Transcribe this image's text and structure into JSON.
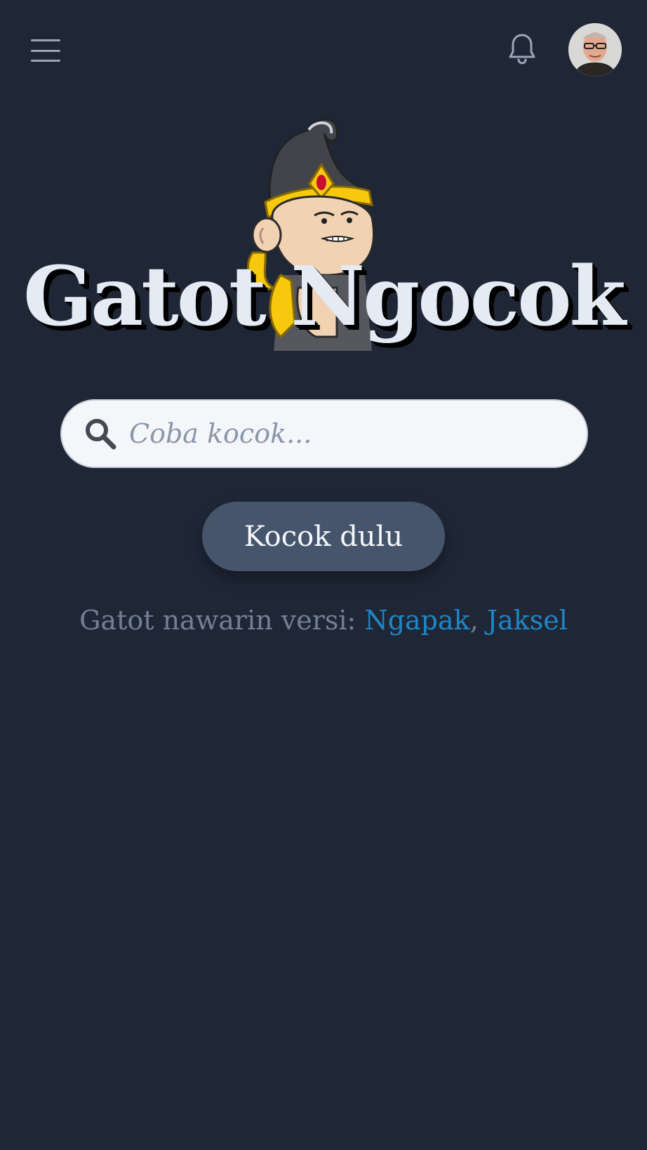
{
  "header": {
    "menu_icon": "hamburger-menu-icon",
    "notification_icon": "bell-icon",
    "avatar": "user-avatar-photo"
  },
  "hero": {
    "title": "Gatot Ngocok",
    "mascot": "gatot-kaca-cartoon-mascot"
  },
  "search": {
    "placeholder": "Coba kocok...",
    "value": "",
    "icon": "search-icon"
  },
  "action": {
    "button_label": "Kocok dulu"
  },
  "versions": {
    "prefix": "Gatot nawarin versi:",
    "links": [
      "Ngapak",
      "Jaksel"
    ]
  },
  "colors": {
    "background": "#1f2736",
    "button": "#46556c",
    "link": "#1f86c6",
    "muted_text": "#738094"
  }
}
